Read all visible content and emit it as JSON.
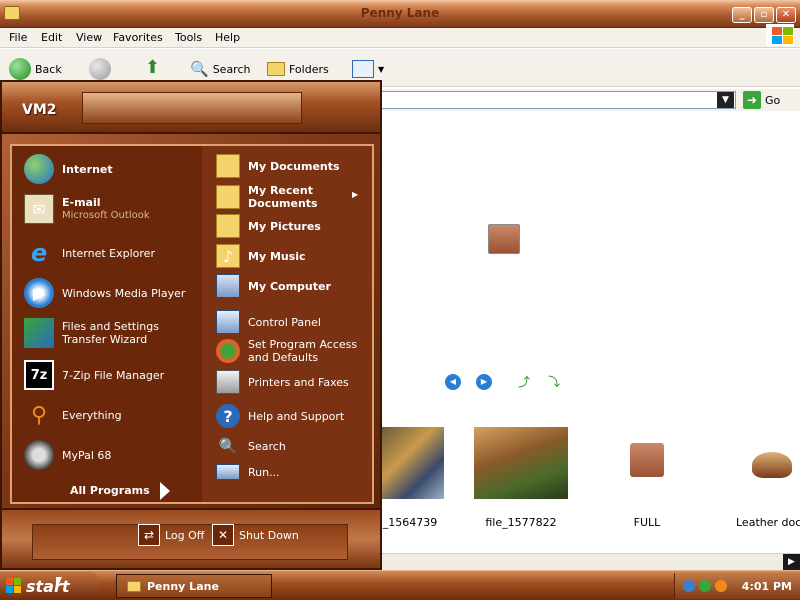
{
  "window": {
    "title": "Penny Lane"
  },
  "menubar": [
    "File",
    "Edit",
    "View",
    "Favorites",
    "Tools",
    "Help"
  ],
  "toolbar": {
    "back": "Back",
    "search": "Search",
    "folders": "Folders"
  },
  "address": {
    "go": "Go"
  },
  "thumbnails": [
    {
      "label": "_1564739"
    },
    {
      "label": "file_1577822"
    },
    {
      "label": "FULL"
    },
    {
      "label": "Leather docs"
    }
  ],
  "startmenu": {
    "user": "VM2",
    "left": [
      {
        "title": "Internet",
        "bold": true
      },
      {
        "title": "E-mail",
        "subtitle": "Microsoft Outlook",
        "bold": true
      },
      {
        "title": "Internet Explorer"
      },
      {
        "title": "Windows Media Player"
      },
      {
        "title": "Files and Settings",
        "title2": "Transfer Wizard"
      },
      {
        "title": "7-Zip File Manager"
      },
      {
        "title": "Everything"
      },
      {
        "title": "MyPal 68"
      }
    ],
    "all_programs": "All Programs",
    "right": [
      {
        "title": "My Documents"
      },
      {
        "title": "My Recent",
        "title2": "Documents"
      },
      {
        "title": "My Pictures"
      },
      {
        "title": "My Music"
      },
      {
        "title": "My Computer"
      },
      {
        "title": "Control Panel"
      },
      {
        "title": "Set Program Access",
        "title2": "and Defaults"
      },
      {
        "title": "Printers and Faxes"
      },
      {
        "title": "Help and Support"
      },
      {
        "title": "Search"
      },
      {
        "title": "Run..."
      }
    ],
    "logoff": "Log Off",
    "shutdown": "Shut Down"
  },
  "taskbar": {
    "start": "start",
    "task": "Penny Lane",
    "clock": "4:01 PM"
  },
  "colors": {
    "accent": "#7d3716",
    "menu_bg": "#6a2709",
    "taskbar": "#a0501e"
  }
}
